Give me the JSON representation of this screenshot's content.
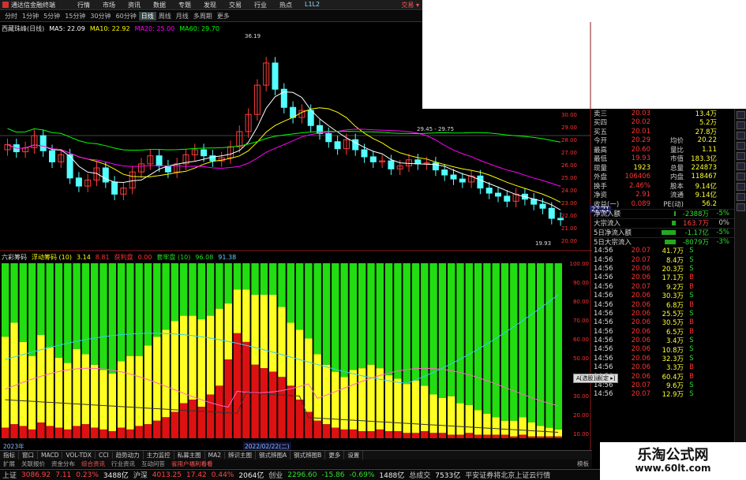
{
  "titlebar": {
    "app_name": "通达信金融终端",
    "menu": [
      "行情",
      "市场",
      "资讯",
      "数据",
      "专题",
      "发现",
      "交易",
      "行业",
      "热点",
      "L1L2"
    ],
    "login": "交易 ▾"
  },
  "periods": [
    "分时",
    "1分钟",
    "5分钟",
    "15分钟",
    "30分钟",
    "60分钟",
    "日线",
    "周线",
    "月线",
    "多周期",
    "更多"
  ],
  "periods_active": "日线",
  "ma_legend": {
    "name": "西藏珠峰(日线)",
    "ma5": "MA5: 22.09",
    "ma10": "MA10: 22.92",
    "ma20": "MA20: 25.00",
    "ma60": "MA60: 29.70"
  },
  "price_annotations": {
    "high": "36.19",
    "mid": "29.45 - 29.75",
    "low": "19.93"
  },
  "price_axis": [
    "30.00",
    "29.00",
    "28.00",
    "27.00",
    "26.00",
    "25.00",
    "24.00",
    "23.00",
    "22.00",
    "21.00",
    "20.00"
  ],
  "current_price_tag": "22.21",
  "sub_legend": {
    "name": "六彩筹码",
    "a": "浮动筹码 (10)",
    "a_val": "3.14",
    "b": "获利盘",
    "b_val": "8.81",
    "c": "0.00",
    "d": "套牢盘 (10)",
    "d_val": "96.08",
    "e": "91.38"
  },
  "sub_axis": [
    "100.00",
    "90.00",
    "80.00",
    "70.00",
    "60.00",
    "50.00",
    "40.00",
    "30.00",
    "20.00",
    "10.00"
  ],
  "quote": [
    {
      "l": "卖三",
      "v1": "20.03",
      "l2": "",
      "v2": "13.4万"
    },
    {
      "l": "买四",
      "v1": "20.02",
      "l2": "",
      "v2": "5.2万"
    },
    {
      "l": "买五",
      "v1": "20.01",
      "l2": "",
      "v2": "27.8万"
    },
    {
      "l": "今开",
      "v1": "20.29",
      "l2": "均价",
      "v2": "20.22"
    },
    {
      "l": "最高",
      "v1": "20.60",
      "l2": "量比",
      "v2": "1.11"
    },
    {
      "l": "最低",
      "v1": "19.93",
      "l2": "市值",
      "v2": "183.3亿"
    },
    {
      "l": "现量",
      "v1": "1923",
      "l2": "总量",
      "v2": "224873"
    },
    {
      "l": "外盘",
      "v1": "106406",
      "l2": "内盘",
      "v2": "118467"
    },
    {
      "l": "换手",
      "v1": "2.46%",
      "l2": "股本",
      "v2": "9.14亿"
    },
    {
      "l": "净资",
      "v1": "2.91",
      "l2": "流通",
      "v2": "9.14亿"
    },
    {
      "l": "收益(一)",
      "v1": "0.089",
      "l2": "PE(动)",
      "v2": "56.2"
    }
  ],
  "flows": [
    {
      "l": "净流入额",
      "bar": 0.05,
      "v": "-2388万",
      "p": "-5%"
    },
    {
      "l": "大宗流入",
      "bar": 0.1,
      "v": "163.7万",
      "p": "0%"
    },
    {
      "l": "5日净流入额",
      "bar": 0.4,
      "v": "-1.17亿",
      "p": "-5%"
    },
    {
      "l": "5日大宗流入",
      "bar": 0.3,
      "v": "-8079万",
      "p": "-3%"
    }
  ],
  "ticks": [
    {
      "t": "14:56",
      "pr": "20.07",
      "vol": "41.7",
      "bs": "S"
    },
    {
      "t": "14:56",
      "pr": "20.07",
      "vol": "8.4",
      "bs": "S"
    },
    {
      "t": "14:56",
      "pr": "20.06",
      "vol": "20.3",
      "bs": "S"
    },
    {
      "t": "14:56",
      "pr": "20.06",
      "vol": "17.1",
      "bs": "B"
    },
    {
      "t": "14:56",
      "pr": "20.07",
      "vol": "9.2",
      "bs": "B"
    },
    {
      "t": "14:56",
      "pr": "20.06",
      "vol": "30.3",
      "bs": "S"
    },
    {
      "t": "14:56",
      "pr": "20.06",
      "vol": "6.8",
      "bs": "B"
    },
    {
      "t": "14:56",
      "pr": "20.06",
      "vol": "25.5",
      "bs": "S"
    },
    {
      "t": "14:56",
      "pr": "20.06",
      "vol": "30.5",
      "bs": "B"
    },
    {
      "t": "14:56",
      "pr": "20.06",
      "vol": "6.5",
      "bs": "B"
    },
    {
      "t": "14:56",
      "pr": "20.06",
      "vol": "3.4",
      "bs": "S"
    },
    {
      "t": "14:56",
      "pr": "20.06",
      "vol": "10.8",
      "bs": "S"
    },
    {
      "t": "14:56",
      "pr": "20.06",
      "vol": "32.3",
      "bs": "S"
    },
    {
      "t": "14:56",
      "pr": "20.06",
      "vol": "3.3",
      "bs": "B"
    },
    {
      "t": "14:56",
      "pr": "20.06",
      "vol": "60.4",
      "bs": "B"
    },
    {
      "t": "14:56",
      "pr": "20.07",
      "vol": "9.6",
      "bs": "S"
    },
    {
      "t": "14:56",
      "pr": "20.07",
      "vol": "12.9",
      "bs": "S"
    }
  ],
  "tick_unit": "万",
  "popup": "A[选股]通[定 ▸]",
  "year_label": "2023年",
  "date_label": "2022/02/22(二)",
  "tabs": [
    "指标",
    "窗口",
    "MACD",
    "VOL-TDX",
    "CCI",
    "趋势动力",
    "主力监控",
    "私募主图",
    "MA2",
    "辨识主图",
    "钢式辨图A",
    "钢式辨图B",
    "更多",
    "设置"
  ],
  "tabs2": [
    "扩展",
    "关联报价",
    "资金分布",
    "综合资讯",
    "行业资讯",
    "互动问答",
    "省用户福利看看"
  ],
  "tabs2_right": "模板",
  "status": [
    {
      "name": "上证",
      "val": "3086.92",
      "chg": "7.11",
      "pct": "0.23%",
      "amt": "3488亿",
      "dir": "up"
    },
    {
      "name": "沪深",
      "val": "4013.25",
      "chg": "17.42",
      "pct": "0.44%",
      "amt": "2064亿",
      "dir": "up"
    },
    {
      "name": "创业",
      "val": "2296.60",
      "chg": "-15.86",
      "pct": "-0.69%",
      "amt": "1488亿",
      "dir": "down"
    }
  ],
  "status_total": "总成交",
  "status_total_val": "7533亿",
  "status_news": "平安证券将北京上证云行情",
  "watermark": {
    "line1": "乐淘公式网",
    "line2": "www.60lt.com"
  },
  "colors": {
    "up": "#ff3c3c",
    "down": "#54ffff",
    "ma5": "#ffffff",
    "ma10": "#ffff00",
    "ma20": "#ff00ff",
    "ma60": "#00ff00",
    "chips_green": "#22dd11",
    "chips_yellow": "#ffff22",
    "chips_red": "#dd1111"
  }
}
